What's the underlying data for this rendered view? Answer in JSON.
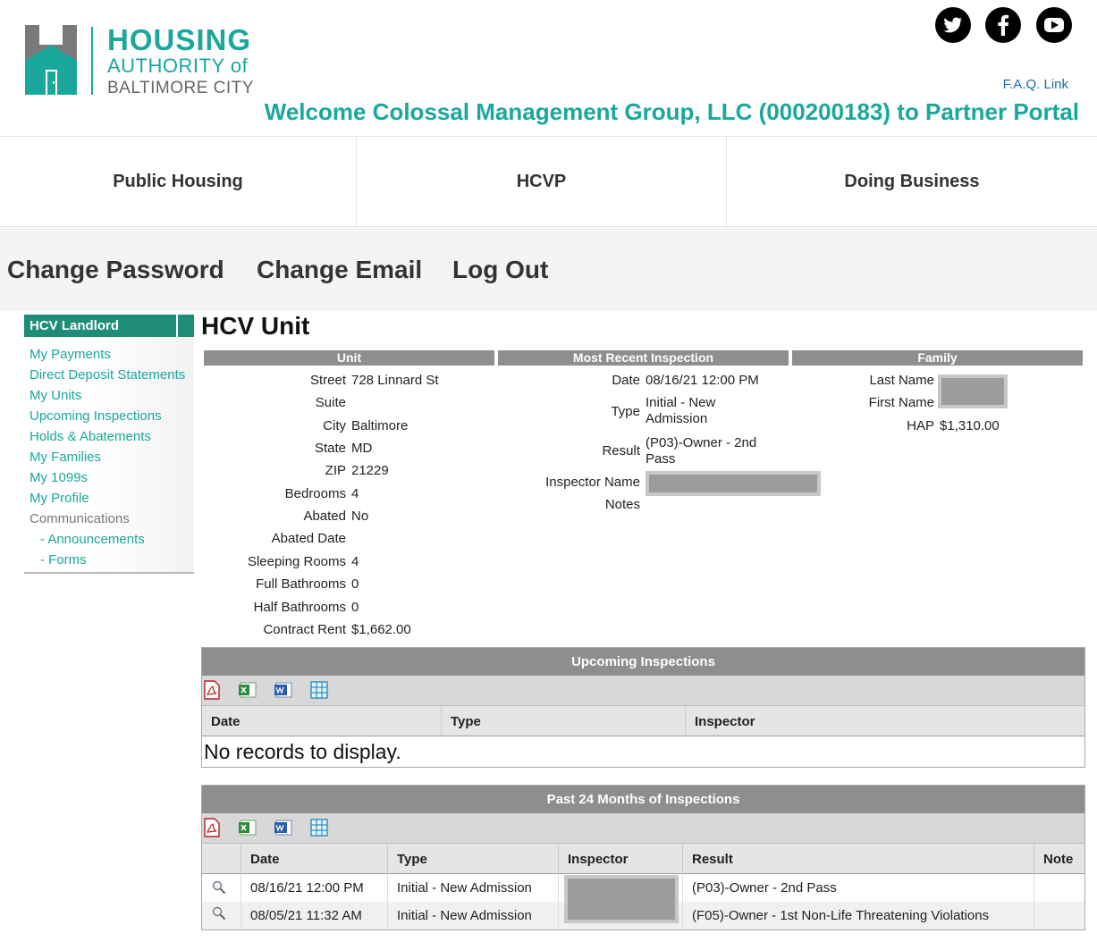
{
  "brand": {
    "line1": "HOUSING",
    "line2": "AUTHORITY of",
    "line3": "BALTIMORE CITY",
    "color": "#1aa79c"
  },
  "header": {
    "social": [
      "twitter-icon",
      "facebook-icon",
      "youtube-icon"
    ],
    "faq_link": "F.A.Q. Link",
    "welcome": "Welcome Colossal Management Group, LLC (000200183) to Partner Portal"
  },
  "main_nav": [
    "Public Housing",
    "HCVP",
    "Doing Business"
  ],
  "account_nav": [
    "Change Password",
    "Change Email",
    "Log Out"
  ],
  "sidebar": {
    "title": "HCV Landlord",
    "items": [
      "My Payments",
      "Direct Deposit Statements",
      "My Units",
      "Upcoming Inspections",
      "Holds & Abatements",
      "My Families",
      "My 1099s",
      "My Profile",
      "Communications",
      "- Announcements",
      "- Forms"
    ]
  },
  "page_title": "HCV Unit",
  "unit": {
    "heading": "Unit",
    "fields": [
      {
        "label": "Street",
        "value": "728 Linnard St"
      },
      {
        "label": "Suite",
        "value": ""
      },
      {
        "label": "City",
        "value": "Baltimore"
      },
      {
        "label": "State",
        "value": "MD"
      },
      {
        "label": "ZIP",
        "value": "21229"
      },
      {
        "label": "Bedrooms",
        "value": "4"
      },
      {
        "label": "Abated",
        "value": "No"
      },
      {
        "label": "Abated Date",
        "value": ""
      },
      {
        "label": "Sleeping Rooms",
        "value": "4"
      },
      {
        "label": "Full Bathrooms",
        "value": "0"
      },
      {
        "label": "Half Bathrooms",
        "value": "0"
      },
      {
        "label": "Contract Rent",
        "value": "$1,662.00"
      }
    ]
  },
  "inspection": {
    "heading": "Most Recent Inspection",
    "date_label": "Date",
    "date": "08/16/21 12:00 PM",
    "type_label": "Type",
    "type": "Initial - New Admission",
    "result_label": "Result",
    "result": "(P03)-Owner - 2nd Pass",
    "inspector_label": "Inspector Name",
    "notes_label": "Notes"
  },
  "family": {
    "heading": "Family",
    "last_name_label": "Last Name",
    "first_name_label": "First Name",
    "hap_label": "HAP",
    "hap": "$1,310.00"
  },
  "upcoming": {
    "caption": "Upcoming Inspections",
    "columns": [
      "Date",
      "Type",
      "Inspector"
    ],
    "empty": "No records to display."
  },
  "past": {
    "caption": "Past 24 Months of Inspections",
    "columns": [
      "Date",
      "Type",
      "Inspector",
      "Result",
      "Note"
    ],
    "rows": [
      {
        "date": "08/16/21 12:00 PM",
        "type": "Initial - New Admission",
        "result": "(P03)-Owner - 2nd Pass",
        "note": ""
      },
      {
        "date": "08/05/21 11:32 AM",
        "type": "Initial - New Admission",
        "result": "(F05)-Owner - 1st Non-Life Threatening Violations",
        "note": ""
      }
    ]
  },
  "export_tools": [
    "pdf-icon",
    "excel-icon",
    "word-icon",
    "csv-icon"
  ]
}
